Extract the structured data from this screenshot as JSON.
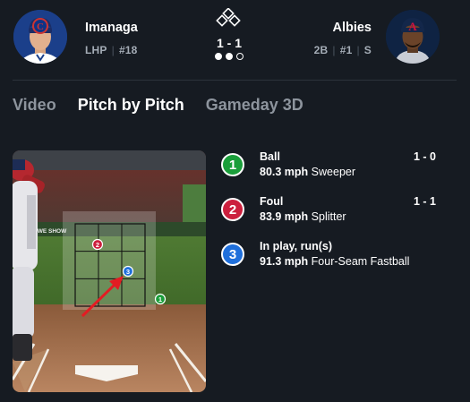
{
  "matchup": {
    "pitcher": {
      "name": "Imanaga",
      "hand": "LHP",
      "number": "#18",
      "team_logo_letter": "C"
    },
    "batter": {
      "name": "Albies",
      "position": "2B",
      "number": "#1",
      "bats": "S",
      "team_logo_letter": "A"
    },
    "count": "1 - 1",
    "outs": [
      true,
      true,
      false
    ],
    "bases_icon": "bases-diamond-icon"
  },
  "tabs": [
    {
      "label": "Video",
      "active": false
    },
    {
      "label": "Pitch by Pitch",
      "active": true
    },
    {
      "label": "Gameday 3D",
      "active": false
    }
  ],
  "zone_view": {
    "scoreboard_text": "BY LOWE SHOW",
    "pitch_markers": [
      {
        "number": "1",
        "color": "#1a9e3a"
      },
      {
        "number": "2",
        "color": "#cc1f3d"
      },
      {
        "number": "3",
        "color": "#1f6fdb"
      }
    ],
    "arrow_color": "#e31c23"
  },
  "pitches": [
    {
      "number": "1",
      "color": "#1a9e3a",
      "result": "Ball",
      "count": "1 - 0",
      "speed": "80.3 mph",
      "type": "Sweeper"
    },
    {
      "number": "2",
      "color": "#cc1f3d",
      "result": "Foul",
      "count": "1 - 1",
      "speed": "83.9 mph",
      "type": "Splitter"
    },
    {
      "number": "3",
      "color": "#1f6fdb",
      "result": "In play, run(s)",
      "count": "",
      "speed": "91.3 mph",
      "type": "Four-Seam Fastball"
    }
  ]
}
